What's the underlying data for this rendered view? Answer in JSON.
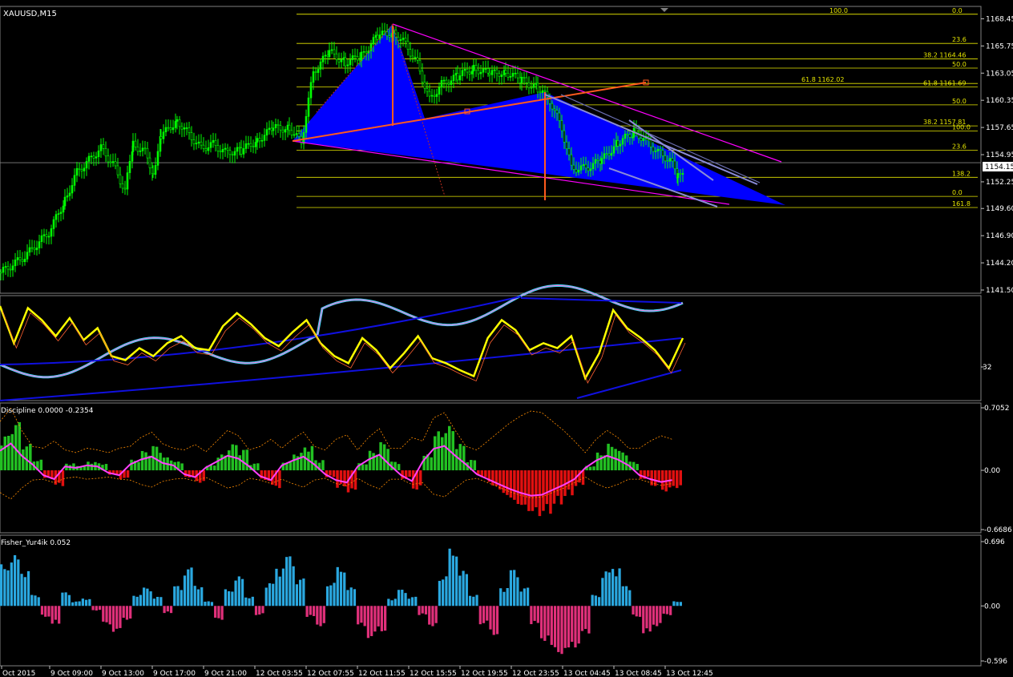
{
  "colors": {
    "background": "#000000",
    "axis": "#c0c0c0",
    "text": "#ffffff",
    "candle": "#00ff00",
    "fib": "#e6e600",
    "harmonic_fill": "#0000ff",
    "channel": "#ff00ff",
    "orange": "#ff5a1e",
    "arrows": "#8a8cd8",
    "rsi": "#ffff00",
    "osc_pos": "#22c022",
    "osc_neg": "#e01010",
    "signal": "#ff40ff",
    "fisher_pos": "#2aa8e0",
    "fisher_neg": "#e0307a"
  },
  "chart_data": [
    {
      "type": "line",
      "title": "XAUUSD,M15",
      "series_note": "candlestick",
      "ylim": [
        1141.5,
        1169.2
      ],
      "yticks": [
        "1168.45",
        "1165.75",
        "1163.05",
        "1160.35",
        "1157.65",
        "1154.95",
        "1152.25",
        "1149.60",
        "1146.90",
        "1144.20",
        "1141.50"
      ],
      "current_price": "1154.15",
      "grid": false,
      "fib_levels": [
        {
          "label": "100.0",
          "price": 1168.9,
          "side": "left"
        },
        {
          "label": "0.0",
          "price": 1168.9,
          "side": "right"
        },
        {
          "label": "23.6",
          "price": 1166.0,
          "side": "right"
        },
        {
          "label": "38.2 1164.46",
          "price": 1164.46,
          "side": "right"
        },
        {
          "label": "50.0",
          "price": 1163.55,
          "side": "right"
        },
        {
          "label": "61.8 1162.02",
          "price": 1162.02,
          "side": "left"
        },
        {
          "label": "61.8 1161.69",
          "price": 1161.69,
          "side": "right"
        },
        {
          "label": "50.0",
          "price": 1159.9,
          "side": "right"
        },
        {
          "label": "38.2 1157.81",
          "price": 1157.81,
          "side": "right"
        },
        {
          "label": "100.0",
          "price": 1157.3,
          "side": "right"
        },
        {
          "label": "23.6",
          "price": 1155.4,
          "side": "right"
        },
        {
          "label": "138.2",
          "price": 1152.7,
          "side": "right"
        },
        {
          "label": "0.0",
          "price": 1150.8,
          "side": "right"
        },
        {
          "label": "161.8",
          "price": 1149.7,
          "side": "right"
        }
      ]
    },
    {
      "type": "line",
      "yticks": [
        "32"
      ],
      "series": [
        {
          "values": [
            0.92,
            0.55,
            0.9,
            0.78,
            0.62,
            0.8,
            0.58,
            0.7,
            0.42,
            0.38,
            0.5,
            0.42,
            0.55,
            0.62,
            0.5,
            0.48,
            0.72,
            0.85,
            0.74,
            0.6,
            0.52,
            0.66,
            0.78,
            0.55,
            0.42,
            0.35,
            0.6,
            0.48,
            0.3,
            0.45,
            0.62,
            0.4,
            0.35,
            0.28,
            0.22,
            0.6,
            0.78,
            0.68,
            0.48,
            0.55,
            0.5,
            0.62,
            0.2,
            0.45,
            0.88,
            0.7,
            0.6,
            0.48,
            0.3,
            0.6
          ]
        }
      ]
    },
    {
      "type": "bar",
      "title": "Discipline 0.0000 -0.2354",
      "yticks": [
        "0.7052",
        "0.00",
        "-0.6686"
      ],
      "ylim": [
        -0.6686,
        0.7052
      ],
      "values": [
        0.4,
        0.55,
        0.3,
        0.12,
        -0.1,
        -0.18,
        0.08,
        0.05,
        0.1,
        0.08,
        -0.05,
        -0.1,
        0.12,
        0.22,
        0.28,
        0.15,
        0.1,
        -0.08,
        -0.14,
        0.06,
        0.18,
        0.3,
        0.24,
        0.08,
        -0.12,
        -0.2,
        0.1,
        0.2,
        0.28,
        0.12,
        -0.08,
        -0.2,
        -0.25,
        0.08,
        0.22,
        0.32,
        0.1,
        -0.1,
        -0.22,
        0.18,
        0.44,
        0.5,
        0.3,
        0.12,
        -0.08,
        -0.18,
        -0.28,
        -0.38,
        -0.46,
        -0.52,
        -0.5,
        -0.4,
        -0.3,
        -0.18,
        0.05,
        0.2,
        0.3,
        0.22,
        0.1,
        -0.1,
        -0.18,
        -0.24,
        -0.2
      ]
    },
    {
      "type": "bar",
      "title": "Fisher_Yur4ik 0.052",
      "yticks": [
        "0.696",
        "0.00",
        "-0.596"
      ],
      "ylim": [
        -0.596,
        0.696
      ],
      "values": [
        0.45,
        0.55,
        0.38,
        0.12,
        -0.12,
        -0.2,
        0.15,
        0.05,
        0.08,
        -0.05,
        -0.2,
        -0.28,
        -0.15,
        0.12,
        0.2,
        0.1,
        -0.08,
        0.22,
        0.42,
        0.22,
        0.05,
        -0.15,
        0.18,
        0.32,
        0.1,
        -0.1,
        0.25,
        0.42,
        0.55,
        0.3,
        -0.12,
        -0.22,
        0.25,
        0.42,
        0.2,
        -0.22,
        -0.35,
        -0.28,
        0.08,
        0.18,
        0.1,
        -0.1,
        -0.22,
        0.32,
        0.62,
        0.38,
        0.12,
        -0.2,
        -0.32,
        0.2,
        0.4,
        0.2,
        -0.2,
        -0.38,
        -0.5,
        -0.52,
        -0.45,
        -0.3,
        0.12,
        0.38,
        0.42,
        0.22,
        -0.12,
        -0.3,
        -0.22,
        -0.1,
        0.05
      ]
    }
  ],
  "x_axis": {
    "labels": [
      "Oct 2015",
      "9 Oct 09:00",
      "9 Oct 13:00",
      "9 Oct 17:00",
      "9 Oct 21:00",
      "12 Oct 03:55",
      "12 Oct 07:55",
      "12 Oct 11:55",
      "12 Oct 15:55",
      "12 Oct 19:55",
      "12 Oct 23:55",
      "13 Oct 04:45",
      "13 Oct 08:45",
      "13 Oct 12:45"
    ]
  }
}
